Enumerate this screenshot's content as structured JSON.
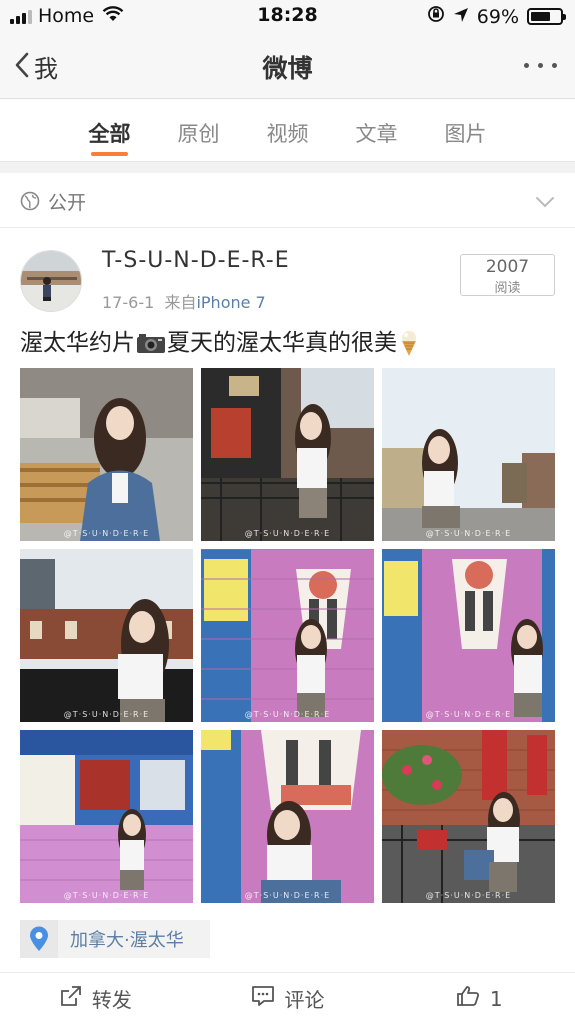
{
  "status_bar": {
    "carrier": "Home",
    "time": "18:28",
    "battery_percent": "69%",
    "battery_level": 0.69
  },
  "nav": {
    "back_label": "我",
    "title": "微博"
  },
  "tabs": [
    {
      "label": "全部",
      "active": true
    },
    {
      "label": "原创",
      "active": false
    },
    {
      "label": "视频",
      "active": false
    },
    {
      "label": "文章",
      "active": false
    },
    {
      "label": "图片",
      "active": false
    }
  ],
  "visibility": {
    "label": "公开"
  },
  "post": {
    "username": "T-S-U-N-D-E-R-E",
    "date": "17-6-1",
    "source_prefix": "来自",
    "source": "iPhone 7",
    "read_count": "2007",
    "read_label": "阅读",
    "text_part1": "渥太华约片",
    "text_part2": "夏天的渥太华真的很美",
    "watermark": "@T·S·U·N·D·E·R·E"
  },
  "location": {
    "label": "加拿大·渥太华"
  },
  "actions": {
    "repost_label": "转发",
    "comment_label": "评论",
    "like_count": "1"
  },
  "colors": {
    "accent": "#fa7d3c",
    "link": "#5b7fa5"
  }
}
